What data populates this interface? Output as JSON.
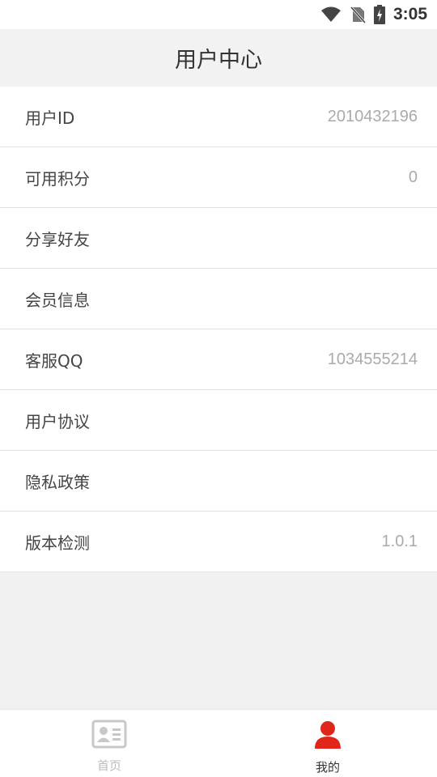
{
  "status_bar": {
    "time": "3:05",
    "icons": [
      "wifi-icon",
      "no-sim-icon",
      "battery-charging-icon"
    ]
  },
  "header": {
    "title": "用户中心"
  },
  "list": {
    "items": [
      {
        "label": "用户ID",
        "value": "2010432196"
      },
      {
        "label": "可用积分",
        "value": "0"
      },
      {
        "label": "分享好友",
        "value": ""
      },
      {
        "label": "会员信息",
        "value": ""
      },
      {
        "label": "客服QQ",
        "value": "1034555214"
      },
      {
        "label": "用户协议",
        "value": ""
      },
      {
        "label": "隐私政策",
        "value": ""
      },
      {
        "label": "版本检测",
        "value": "1.0.1"
      }
    ]
  },
  "bottom_nav": {
    "items": [
      {
        "label": "首页",
        "icon": "contact-card-icon",
        "active": false
      },
      {
        "label": "我的",
        "icon": "user-icon",
        "active": true
      }
    ]
  },
  "colors": {
    "accent": "#e0251b",
    "inactive": "#bdbdbd"
  }
}
